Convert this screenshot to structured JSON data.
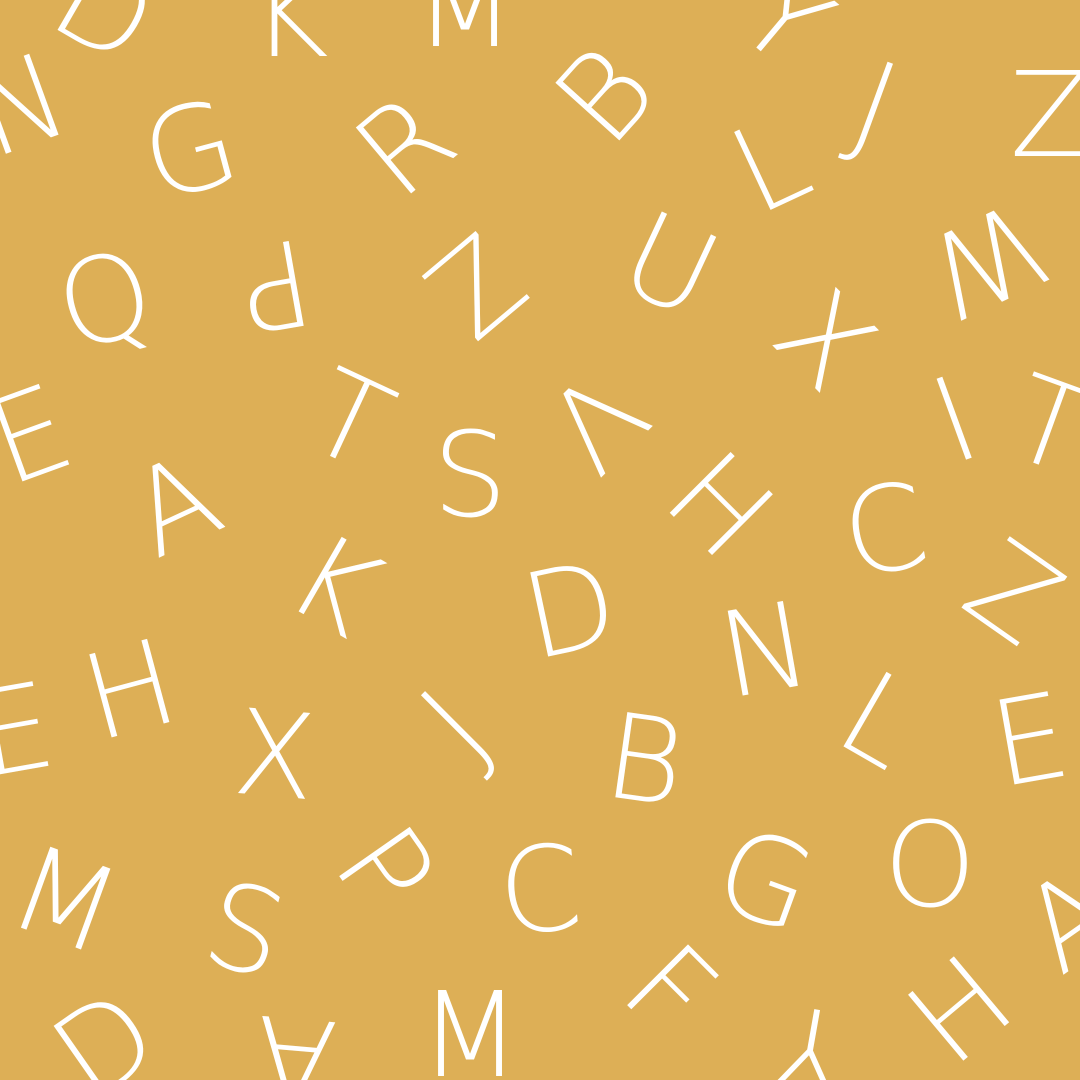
{
  "background_color": "#DDAF56",
  "letter_color": "#FFFFFF",
  "letters": [
    {
      "char": "D",
      "name": "letter-d-top-left-edge"
    },
    {
      "char": "K",
      "name": "letter-k-top"
    },
    {
      "char": "M",
      "name": "letter-m-top-edge"
    },
    {
      "char": "Y",
      "name": "letter-y-top-right"
    },
    {
      "char": "N",
      "name": "letter-n-left-edge"
    },
    {
      "char": "G",
      "name": "letter-g"
    },
    {
      "char": "R",
      "name": "letter-r"
    },
    {
      "char": "B",
      "name": "letter-b-top"
    },
    {
      "char": "J",
      "name": "letter-j"
    },
    {
      "char": "L",
      "name": "letter-l-top"
    },
    {
      "char": "Z",
      "name": "letter-z-right-edge"
    },
    {
      "char": "Q",
      "name": "letter-q"
    },
    {
      "char": "P",
      "name": "letter-p"
    },
    {
      "char": "Z",
      "name": "letter-z"
    },
    {
      "char": "U",
      "name": "letter-u"
    },
    {
      "char": "W",
      "name": "letter-w"
    },
    {
      "char": "X",
      "name": "letter-x-top"
    },
    {
      "char": "T",
      "name": "letter-t"
    },
    {
      "char": "S",
      "name": "letter-s-center"
    },
    {
      "char": "V",
      "name": "letter-v"
    },
    {
      "char": "I",
      "name": "letter-i"
    },
    {
      "char": "E",
      "name": "letter-e-left-edge"
    },
    {
      "char": "T",
      "name": "letter-t-right-edge"
    },
    {
      "char": "A",
      "name": "letter-a"
    },
    {
      "char": "H",
      "name": "letter-h-center"
    },
    {
      "char": "C",
      "name": "letter-c-right"
    },
    {
      "char": "K",
      "name": "letter-k-center"
    },
    {
      "char": "D",
      "name": "letter-d-center"
    },
    {
      "char": "N",
      "name": "letter-n-center"
    },
    {
      "char": "Z",
      "name": "letter-z-right"
    },
    {
      "char": "H",
      "name": "letter-h-left"
    },
    {
      "char": "J",
      "name": "letter-j-center"
    },
    {
      "char": "B",
      "name": "letter-b-center"
    },
    {
      "char": "L",
      "name": "letter-l-right"
    },
    {
      "char": "E",
      "name": "letter-e-left-lower-edge"
    },
    {
      "char": "X",
      "name": "letter-x-lower"
    },
    {
      "char": "E",
      "name": "letter-e-right"
    },
    {
      "char": "M",
      "name": "letter-m-left"
    },
    {
      "char": "S",
      "name": "letter-s-lower"
    },
    {
      "char": "P",
      "name": "letter-p-lower"
    },
    {
      "char": "C",
      "name": "letter-c-lower"
    },
    {
      "char": "G",
      "name": "letter-g-lower"
    },
    {
      "char": "O",
      "name": "letter-o"
    },
    {
      "char": "D",
      "name": "letter-d-bottom-left"
    },
    {
      "char": "A",
      "name": "letter-a-bottom-edge"
    },
    {
      "char": "M",
      "name": "letter-m-bottom"
    },
    {
      "char": "F",
      "name": "letter-f"
    },
    {
      "char": "Y",
      "name": "letter-y-bottom-edge"
    },
    {
      "char": "H",
      "name": "letter-h-bottom-right"
    },
    {
      "char": "A",
      "name": "letter-a-right-edge"
    }
  ]
}
